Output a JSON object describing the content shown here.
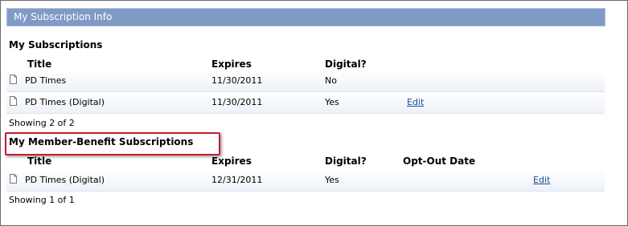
{
  "panel": {
    "title": "My Subscription Info"
  },
  "subscriptions": {
    "heading": "My Subscriptions",
    "columns": {
      "title": "Title",
      "expires": "Expires",
      "digital": "Digital?"
    },
    "rows": [
      {
        "title": "PD Times",
        "expires": "11/30/2011",
        "digital": "No",
        "edit": ""
      },
      {
        "title": "PD Times (Digital)",
        "expires": "11/30/2011",
        "digital": "Yes",
        "edit": "Edit"
      }
    ],
    "showing": "Showing 2 of 2"
  },
  "member_benefit": {
    "heading": "My Member-Benefit Subscriptions",
    "columns": {
      "title": "Title",
      "expires": "Expires",
      "digital": "Digital?",
      "opt_out": "Opt-Out Date"
    },
    "rows": [
      {
        "title": "PD Times (Digital)",
        "expires": "12/31/2011",
        "digital": "Yes",
        "opt_out": "",
        "edit": "Edit"
      }
    ],
    "showing": "Showing 1 of 1"
  },
  "icons": {
    "row_icon": "document-icon"
  },
  "colors": {
    "header_bg": "#7f9ac5",
    "link": "#1a4f9c",
    "highlight": "#c0202a"
  }
}
